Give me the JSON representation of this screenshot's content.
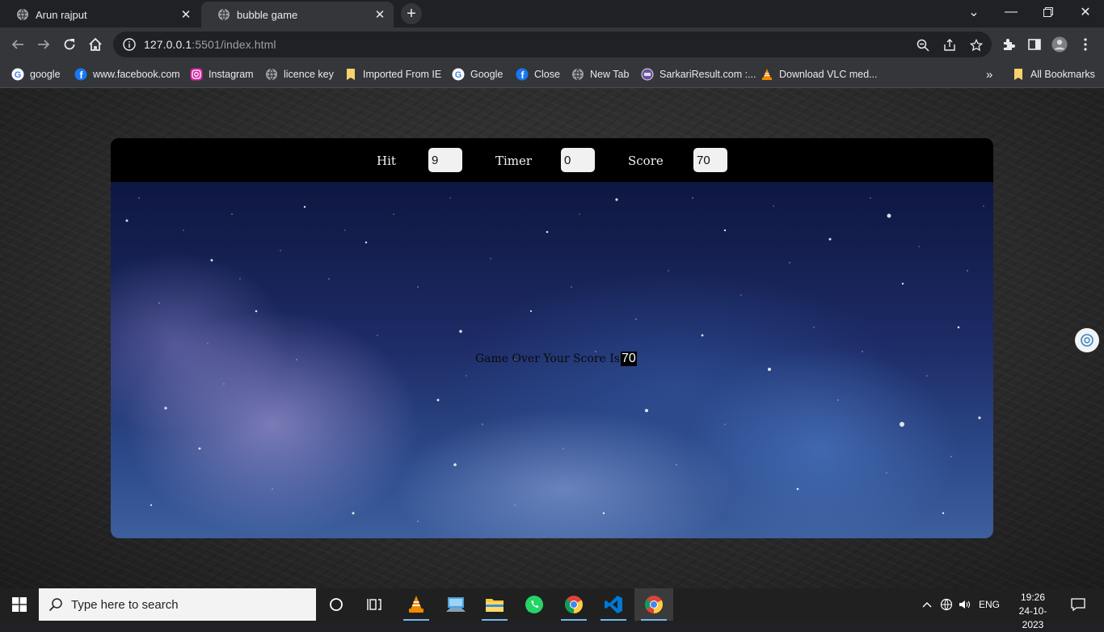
{
  "browser": {
    "tabs": [
      {
        "label": "Arun rajput",
        "icon": "globe-icon",
        "active": false
      },
      {
        "label": "bubble game",
        "icon": "globe-icon",
        "active": true
      }
    ],
    "address": {
      "host": "127.0.0.1",
      "rest": ":5501/index.html"
    },
    "bookmarks": [
      {
        "label": "google",
        "icon": "google-icon"
      },
      {
        "label": "www.facebook.com",
        "icon": "facebook-icon"
      },
      {
        "label": "Instagram",
        "icon": "instagram-icon"
      },
      {
        "label": "licence key",
        "icon": "globe-icon"
      },
      {
        "label": "Imported From IE",
        "icon": "folder-icon"
      },
      {
        "label": "Google",
        "icon": "google-icon"
      },
      {
        "label": "Close",
        "icon": "facebook-icon"
      },
      {
        "label": "New Tab",
        "icon": "globe-icon"
      },
      {
        "label": "SarkariResult.com :...",
        "icon": "sarkari-icon"
      },
      {
        "label": "Download VLC med...",
        "icon": "vlc-icon"
      }
    ],
    "all_bookmarks": "All Bookmarks"
  },
  "game": {
    "hit_label": "Hit",
    "hit_value": "9",
    "timer_label": "Timer",
    "timer_value": "0",
    "score_label": "Score",
    "score_value": "70",
    "game_over_text": "Game Over Your Score Is",
    "final_score": "70"
  },
  "taskbar": {
    "search_placeholder": "Type here to search",
    "language": "ENG",
    "time": "19:26",
    "date": "24-10-2023"
  },
  "colors": {
    "chrome_dark": "#202124",
    "chrome_toolbar": "#35363a",
    "game_bar": "#000000",
    "accent_blue": "#76b9ed"
  }
}
